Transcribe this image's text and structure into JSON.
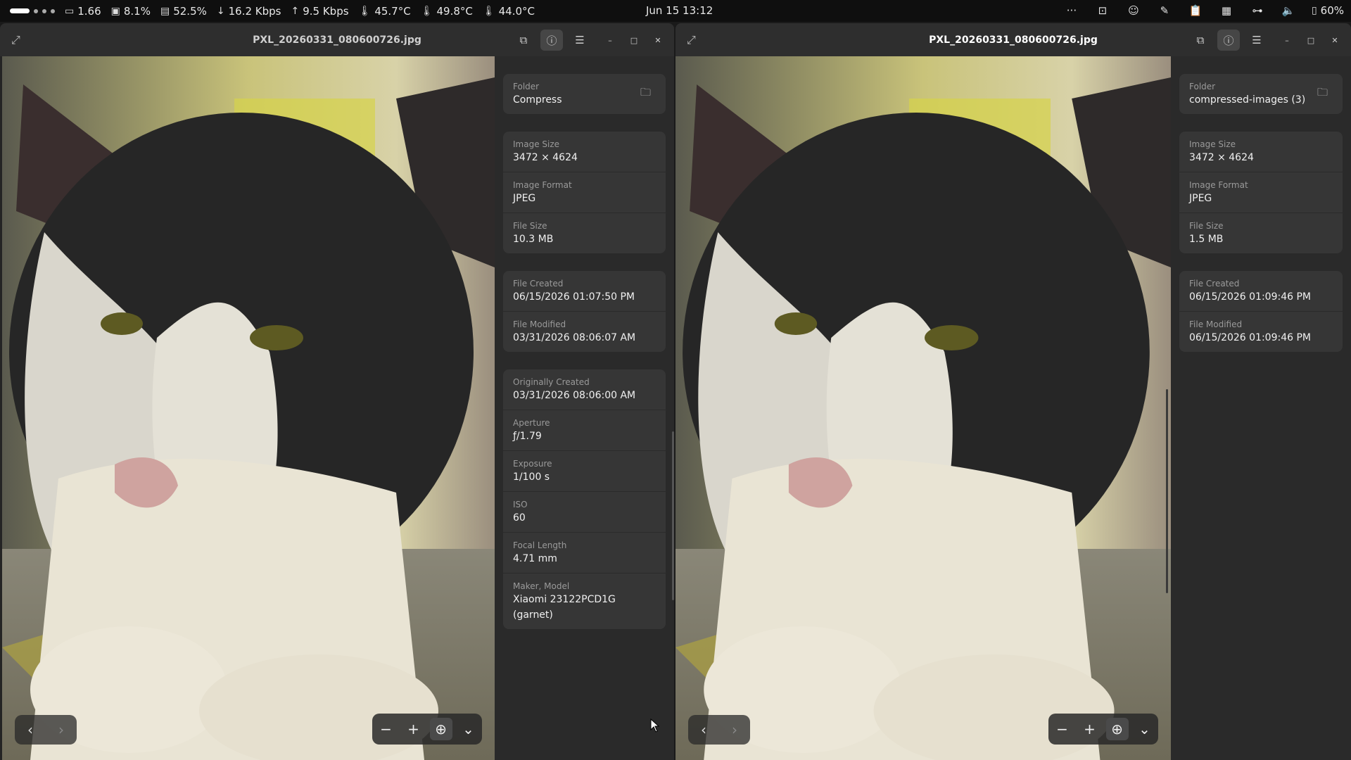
{
  "topbar": {
    "cpu_load": "1.66",
    "cpu_percent": "8.1%",
    "mem_percent": "52.5%",
    "net_down": "16.2 Kbps",
    "net_up": "9.5 Kbps",
    "temp1": "45.7°C",
    "temp2": "49.8°C",
    "temp3": "44.0°C",
    "clock": "Jun 15  13:12",
    "overflow": "···",
    "battery": "60%"
  },
  "left_window": {
    "title": "PXL_20260331_080600726.jpg",
    "folder": {
      "label": "Folder",
      "value": "Compress"
    },
    "image_info": [
      {
        "label": "Image Size",
        "value": "3472 × 4624"
      },
      {
        "label": "Image Format",
        "value": "JPEG"
      },
      {
        "label": "File Size",
        "value": "10.3 MB"
      }
    ],
    "dates": [
      {
        "label": "File Created",
        "value": "06/15/2026 01:07:50 PM"
      },
      {
        "label": "File Modified",
        "value": "03/31/2026 08:06:07 AM"
      }
    ],
    "exif": [
      {
        "label": "Originally Created",
        "value": "03/31/2026 08:06:00 AM"
      },
      {
        "label": "Aperture",
        "value": "ƒ/1.79"
      },
      {
        "label": "Exposure",
        "value": "1/100 s"
      },
      {
        "label": "ISO",
        "value": "60"
      },
      {
        "label": "Focal Length",
        "value": "4.71 mm"
      },
      {
        "label": "Maker, Model",
        "value": "Xiaomi 23122PCD1G (garnet)"
      }
    ]
  },
  "right_window": {
    "title": "PXL_20260331_080600726.jpg",
    "folder": {
      "label": "Folder",
      "value": "compressed-images (3)"
    },
    "image_info": [
      {
        "label": "Image Size",
        "value": "3472 × 4624"
      },
      {
        "label": "Image Format",
        "value": "JPEG"
      },
      {
        "label": "File Size",
        "value": "1.5 MB"
      }
    ],
    "dates": [
      {
        "label": "File Created",
        "value": "06/15/2026 01:09:46 PM"
      },
      {
        "label": "File Modified",
        "value": "06/15/2026 01:09:46 PM"
      }
    ]
  },
  "icons": {
    "prev": "‹",
    "next": "›",
    "zoom_out": "−",
    "zoom_in": "+",
    "zoom_fit": "⊕",
    "zoom_menu": "⌄",
    "crop": "⧉",
    "info": "ⓘ",
    "menu": "☰",
    "minimize": "–",
    "maximize": "□",
    "close": "✕",
    "expand": "⤢",
    "folder": "🗀"
  },
  "colors": {
    "accent": "#ffffff",
    "panel": "#363636",
    "header": "#2e2e2e"
  }
}
